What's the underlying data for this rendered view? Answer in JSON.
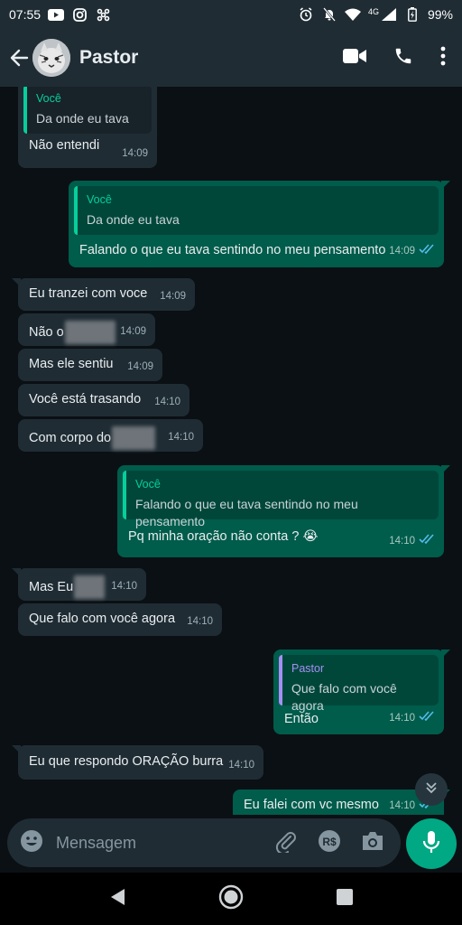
{
  "status": {
    "time": "07:55",
    "network": "4G",
    "battery": "99%"
  },
  "header": {
    "contact": "Pastor"
  },
  "messages": [
    {
      "quote_author": "Você",
      "quote_text": "Da onde eu tava",
      "text": "Não entendi",
      "time": "14:09"
    },
    {
      "quote_author": "Você",
      "quote_text": "Da onde eu tava",
      "text": "Falando o que eu tava sentindo no meu pensamento",
      "time": "14:09"
    },
    {
      "text": "Eu tranzei com voce",
      "time": "14:09"
    },
    {
      "text": "Não o",
      "time": "14:09"
    },
    {
      "text": "Mas ele sentiu",
      "time": "14:09"
    },
    {
      "text": "Você está trasando",
      "time": "14:10"
    },
    {
      "text": "Com corpo do",
      "time": "14:10"
    },
    {
      "quote_author": "Você",
      "quote_text": "Falando o que eu tava sentindo no meu pensamento",
      "text": "Pq minha oração não conta ? 😭",
      "time": "14:10"
    },
    {
      "text": "Mas Eu",
      "time": "14:10"
    },
    {
      "text": "Que falo com você agora",
      "time": "14:10"
    },
    {
      "quote_author": "Pastor",
      "quote_text": "Que falo com você agora",
      "text": "Então",
      "time": "14:10"
    },
    {
      "text": "Eu que respondo ORAÇÃO burra",
      "time": "14:10"
    },
    {
      "text": "Eu falei com vc mesmo",
      "time": "14:10"
    }
  ],
  "input": {
    "placeholder": "Mensagem"
  },
  "colors": {
    "incoming": "#1f2c34",
    "outgoing": "#005c4b",
    "accent": "#00a884",
    "read_ticks": "#53bdeb"
  }
}
